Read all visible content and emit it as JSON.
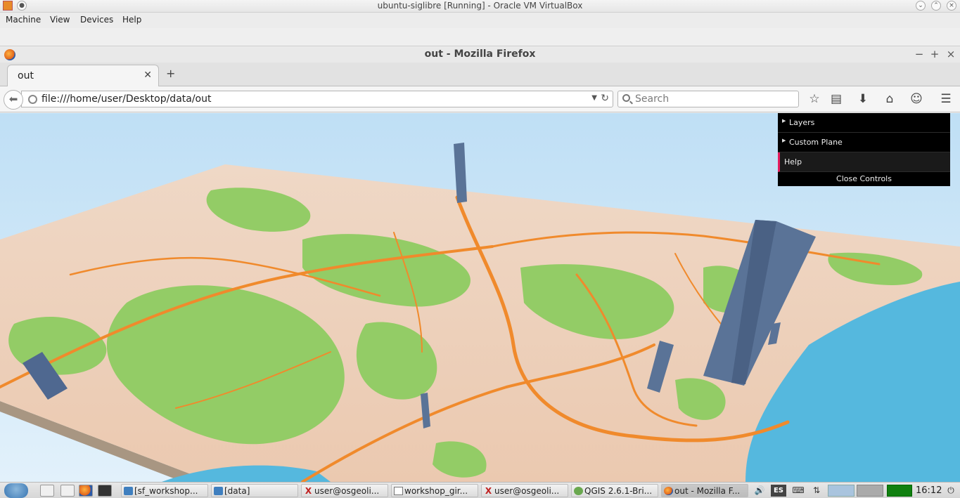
{
  "host": {
    "title": "ubuntu-siglibre [Running] - Oracle VM VirtualBox",
    "menu": [
      "Machine",
      "View",
      "Devices",
      "Help"
    ]
  },
  "browser": {
    "window_title": "out - Mozilla Firefox",
    "tab_label": "out",
    "url": "file:///home/user/Desktop/data/out",
    "search_placeholder": "Search"
  },
  "gui": {
    "folders": [
      "Layers",
      "Custom Plane"
    ],
    "help_label": "Help",
    "close_label": "Close Controls"
  },
  "scene": {
    "content": "3D map with extruded columns",
    "colors": {
      "sky": "#c6e3f6",
      "land": "#ecd3bd",
      "green": "#8ecb5f",
      "road": "#f08a2c",
      "sea": "#4fb3dc",
      "column": "#5a7397",
      "base": "#a89682"
    }
  },
  "taskbar": {
    "items": [
      {
        "label": "[sf_workshop...",
        "icon": "folder-icon"
      },
      {
        "label": "[data]",
        "icon": "folder-icon"
      },
      {
        "label": "user@osgeoli...",
        "icon": "xterm-icon"
      },
      {
        "label": "workshop_gir...",
        "icon": "document-icon"
      },
      {
        "label": "user@osgeoli...",
        "icon": "xterm-icon"
      },
      {
        "label": "QGIS 2.6.1-Bri...",
        "icon": "qgis-icon"
      },
      {
        "label": "out - Mozilla F...",
        "icon": "firefox-icon",
        "active": true
      }
    ],
    "keyboard_layout": "ES",
    "clock": "16:12"
  }
}
